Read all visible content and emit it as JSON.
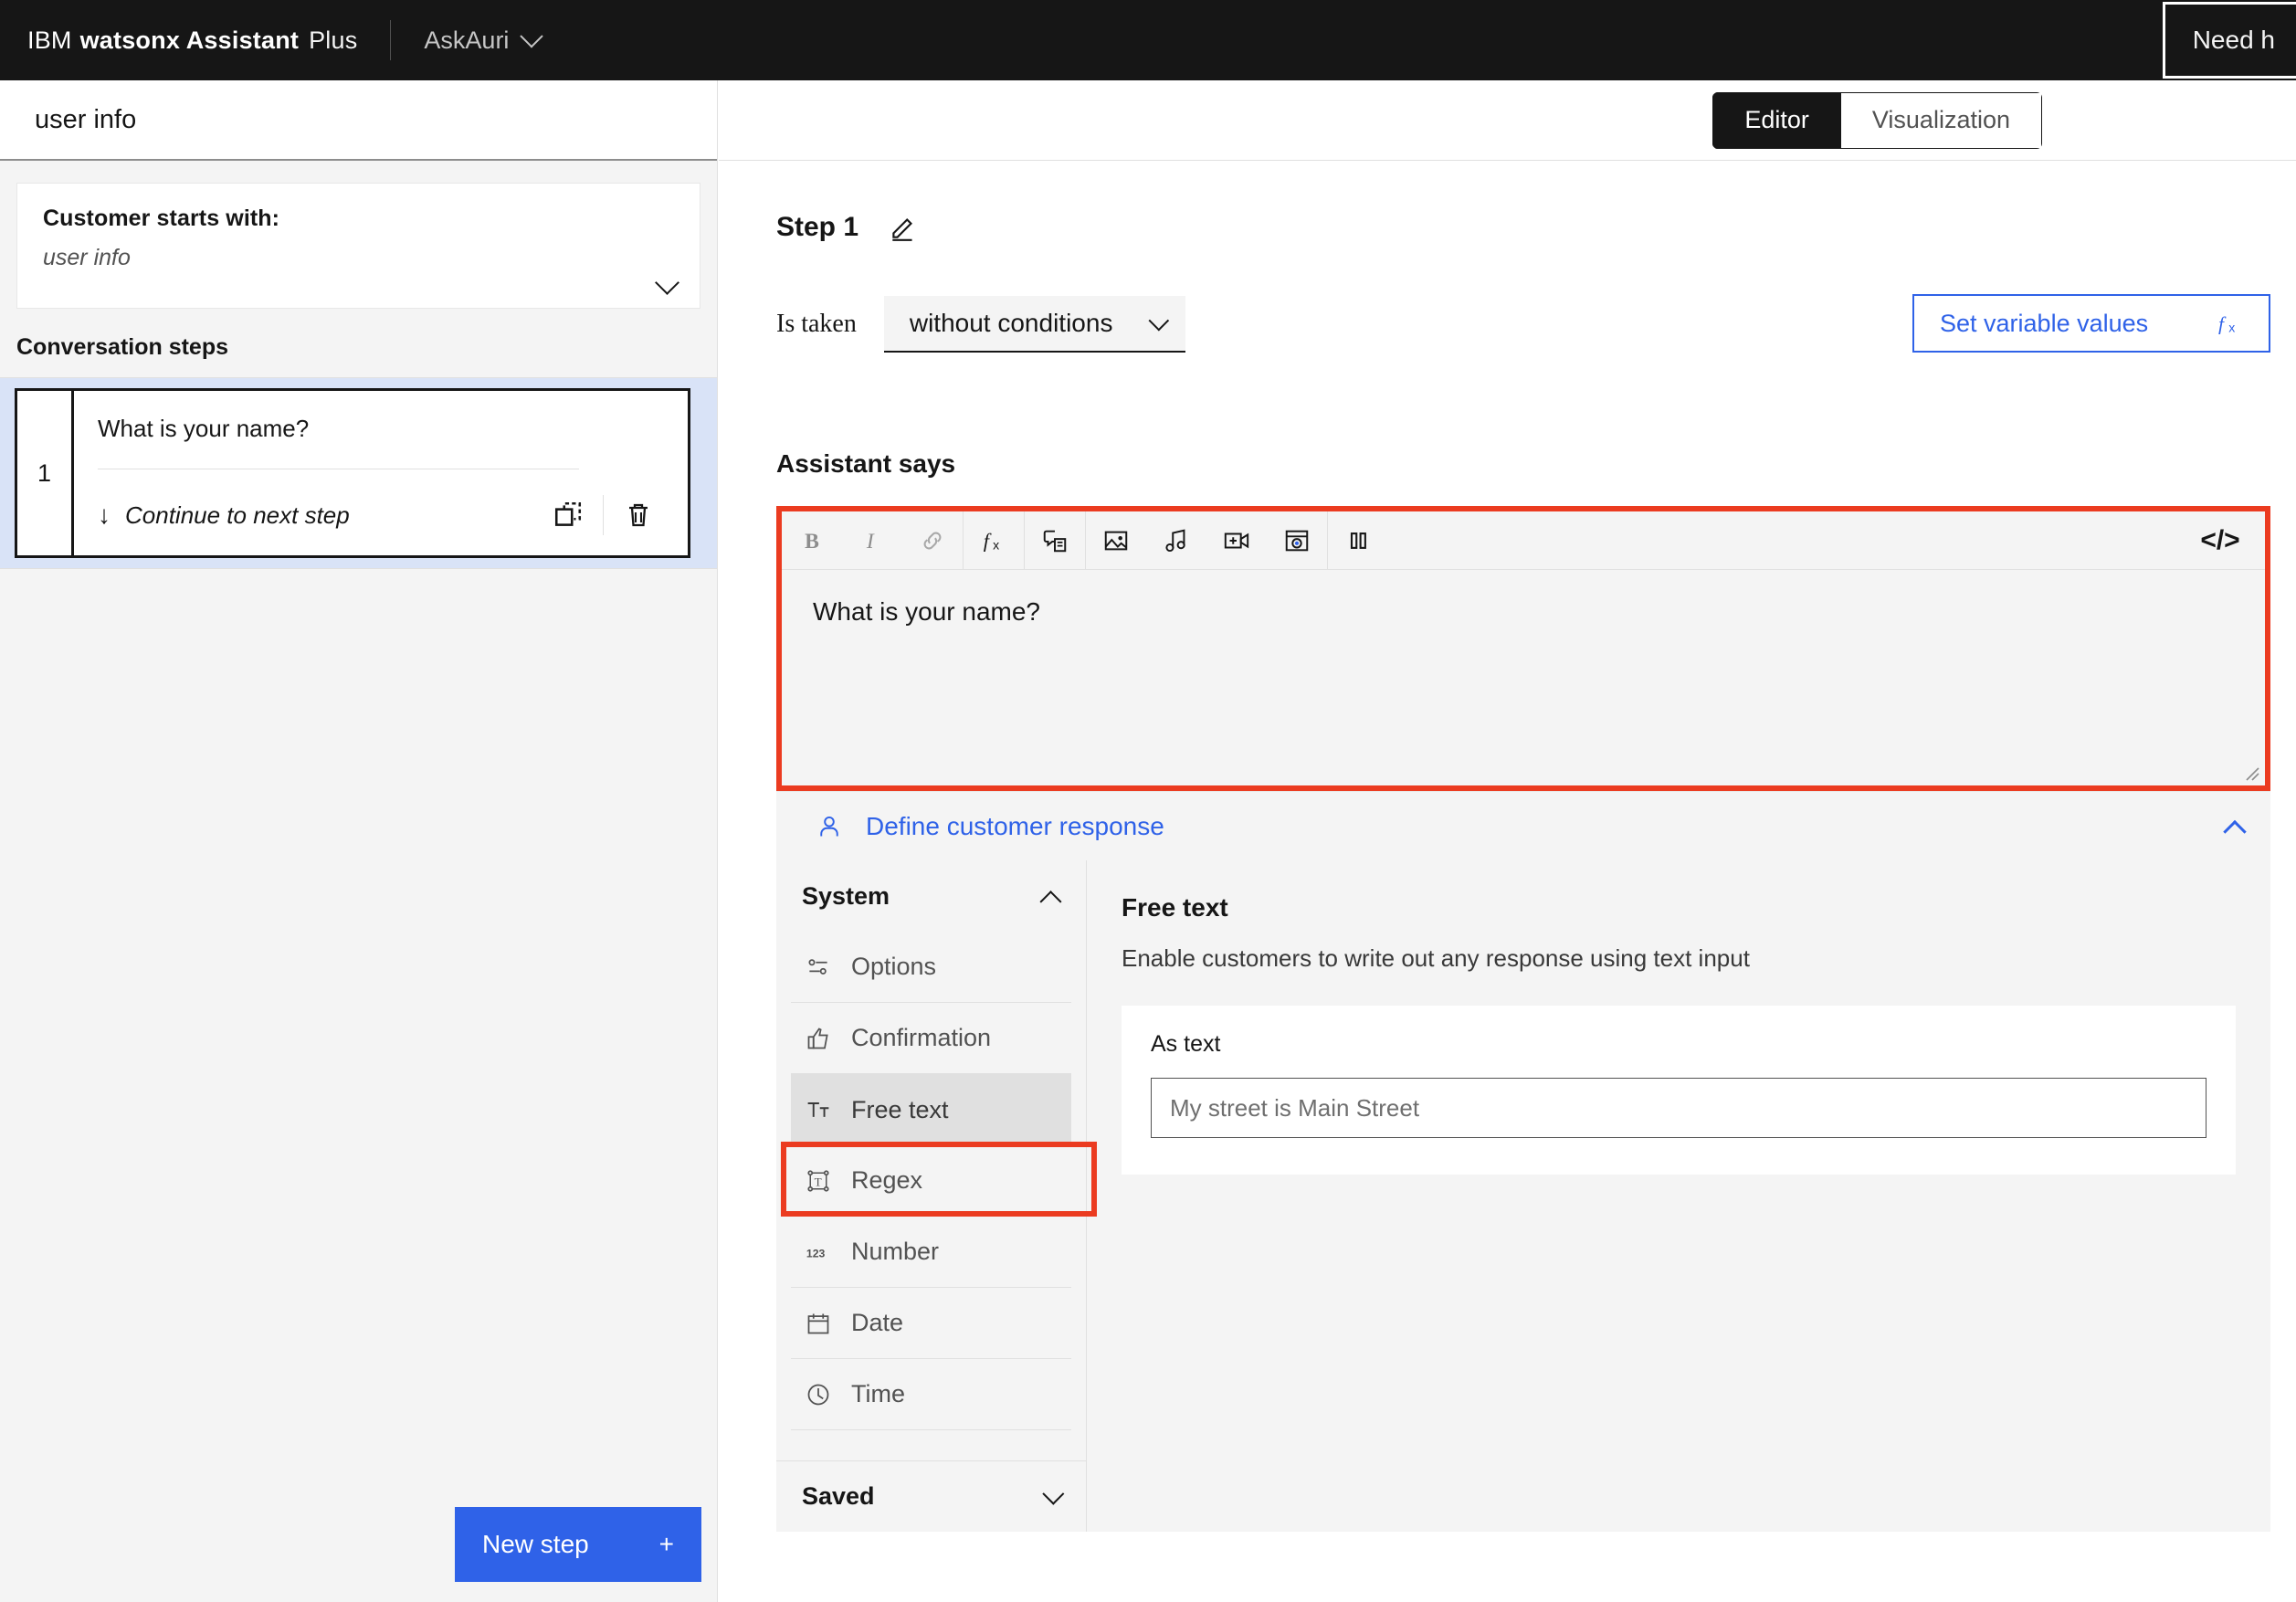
{
  "header": {
    "ibm": "IBM",
    "product": "watsonx Assistant",
    "plan": "Plus",
    "assistant_name": "AskAuri",
    "assistant_chevron_icon": "chevron-down-icon",
    "need_help": "Need h"
  },
  "left_panel": {
    "flow_title": "user info",
    "starts_with_label": "Customer starts with:",
    "starts_with_value": "user info",
    "starts_with_chevron_icon": "chevron-down-icon",
    "conversation_steps_label": "Conversation steps",
    "steps": [
      {
        "number": "1",
        "text": "What is your name?",
        "transition_arrow_icon": "arrow-down-icon",
        "transition": "Continue to next step",
        "duplicate_icon": "copy-icon",
        "delete_icon": "trash-icon"
      }
    ],
    "new_step_label": "New step",
    "new_step_icon": "plus-icon"
  },
  "main": {
    "tabs": [
      {
        "label": "Editor",
        "active": true
      },
      {
        "label": "Visualization",
        "active": false
      }
    ],
    "step_title": "Step 1",
    "edit_icon": "pencil-icon",
    "condition_label": "Is taken",
    "condition_value": "without conditions",
    "condition_chevron_icon": "chevron-down-icon",
    "set_variable_values": "Set variable values",
    "set_variable_icon": "fx-icon",
    "assistant_says_label": "Assistant says",
    "toolbar": [
      {
        "name": "bold-icon",
        "glyph": "B"
      },
      {
        "name": "italic-icon",
        "glyph": "I"
      },
      {
        "name": "link-icon",
        "glyph": "link"
      },
      {
        "name": "variable-fx-icon",
        "glyph": "fx"
      },
      {
        "name": "conversational-search-icon",
        "glyph": "script"
      },
      {
        "name": "image-icon",
        "glyph": "image"
      },
      {
        "name": "audio-icon",
        "glyph": "music"
      },
      {
        "name": "video-icon",
        "glyph": "video"
      },
      {
        "name": "iframe-icon",
        "glyph": "iframe"
      },
      {
        "name": "pause-icon",
        "glyph": "pause"
      }
    ],
    "code_view_icon": "</>",
    "response_text": "What is your name?",
    "define_customer_response": "Define customer response",
    "define_user_icon": "user-icon",
    "define_collapse_icon": "chevron-up-icon",
    "response_types": {
      "system_label": "System",
      "system_chevron_icon": "chevron-up-icon",
      "items": [
        {
          "label": "Options",
          "icon": "options-icon",
          "selected": false
        },
        {
          "label": "Confirmation",
          "icon": "thumbs-up-icon",
          "selected": false
        },
        {
          "label": "Free text",
          "icon": "text-icon",
          "selected": true
        },
        {
          "label": "Regex",
          "icon": "regex-icon",
          "selected": false
        },
        {
          "label": "Number",
          "icon": "number-123-icon",
          "selected": false
        },
        {
          "label": "Date",
          "icon": "calendar-icon",
          "selected": false
        },
        {
          "label": "Time",
          "icon": "clock-icon",
          "selected": false
        }
      ],
      "saved_label": "Saved",
      "saved_chevron_icon": "chevron-down-icon"
    },
    "detail": {
      "title": "Free text",
      "description": "Enable customers to write out any response using text input",
      "as_text_label": "As text",
      "as_text_placeholder": "My street is Main Street"
    }
  },
  "colors": {
    "highlight": "#eb3b20",
    "accent_blue": "#2f62e8",
    "header_bg": "#161616",
    "panel_bg": "#f4f4f4",
    "selected_step_bg": "#d9e3f7"
  }
}
